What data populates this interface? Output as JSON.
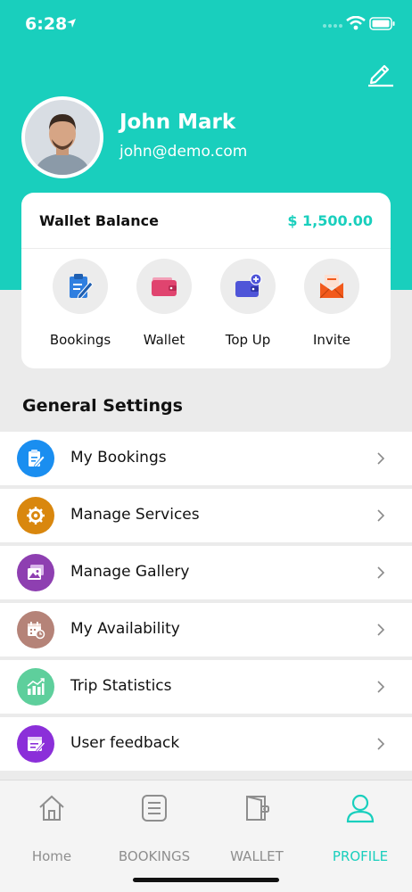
{
  "status_bar": {
    "time": "6:28"
  },
  "profile": {
    "name": "John Mark",
    "email": "john@demo.com"
  },
  "wallet": {
    "title": "Wallet Balance",
    "amount": "$ 1,500.00"
  },
  "quick_actions": [
    {
      "label": "Bookings",
      "icon": "clipboard-edit-icon",
      "color": "#2f7fe0"
    },
    {
      "label": "Wallet",
      "icon": "wallet-icon",
      "color": "#e0446f"
    },
    {
      "label": "Top Up",
      "icon": "wallet-add-icon",
      "color": "#4f55d8"
    },
    {
      "label": "Invite",
      "icon": "envelope-icon",
      "color": "#f25a1c"
    }
  ],
  "general_settings": {
    "title": "General Settings",
    "items": [
      {
        "label": "My Bookings",
        "icon": "booking-edit-icon",
        "color": "#1a8ef0"
      },
      {
        "label": "Manage Services",
        "icon": "services-gear-icon",
        "color": "#d9870e"
      },
      {
        "label": "Manage Gallery",
        "icon": "gallery-icon",
        "color": "#8e3fb1"
      },
      {
        "label": "My Availability",
        "icon": "calendar-clock-icon",
        "color": "#b58378"
      },
      {
        "label": "Trip Statistics",
        "icon": "stats-chart-icon",
        "color": "#5ecf9c"
      },
      {
        "label": "User feedback",
        "icon": "feedback-form-icon",
        "color": "#8b2fd9"
      }
    ]
  },
  "tabs": [
    {
      "label": "Home",
      "icon": "home-icon",
      "active": false
    },
    {
      "label": "BOOKINGS",
      "icon": "list-icon",
      "active": false
    },
    {
      "label": "WALLET",
      "icon": "wallet-tab-icon",
      "active": false
    },
    {
      "label": "PROFILE",
      "icon": "profile-icon",
      "active": true
    }
  ],
  "colors": {
    "accent": "#19cfbd",
    "background": "#ebebeb",
    "inactive_tab": "#8e8e8e"
  }
}
